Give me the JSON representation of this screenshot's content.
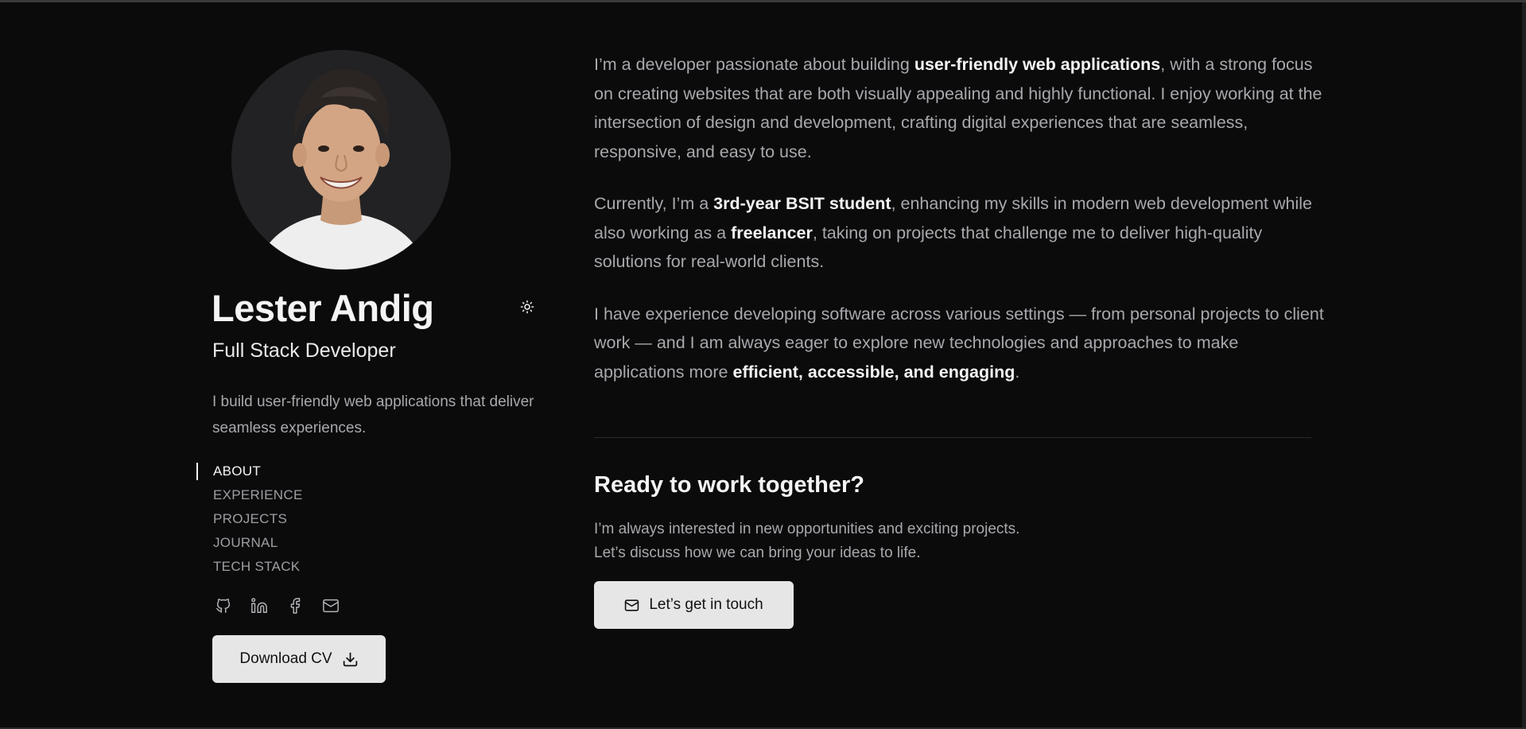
{
  "profile": {
    "name": "Lester Andig",
    "role": "Full Stack Developer",
    "tagline": "I build user-friendly web applications that deliver seamless experiences."
  },
  "nav": {
    "items": [
      {
        "label": "ABOUT",
        "active": true
      },
      {
        "label": "EXPERIENCE",
        "active": false
      },
      {
        "label": "PROJECTS",
        "active": false
      },
      {
        "label": "JOURNAL",
        "active": false
      },
      {
        "label": "TECH STACK",
        "active": false
      }
    ]
  },
  "socials": [
    {
      "icon": "github-icon"
    },
    {
      "icon": "linkedin-icon"
    },
    {
      "icon": "facebook-icon"
    },
    {
      "icon": "mail-icon"
    }
  ],
  "download_button": {
    "label": "Download CV",
    "icon": "download-icon"
  },
  "theme_toggle": {
    "icon": "sun-icon"
  },
  "about": {
    "p1": {
      "a": "I’m a developer passionate about building ",
      "b": "user-friendly web applications",
      "c": ", with a strong focus on creating websites that are both visually appealing and highly functional. I enjoy working at the intersection of design and development, crafting digital experiences that are seamless, responsive, and easy to use."
    },
    "p2": {
      "a": "Currently, I’m a ",
      "b": "3rd-year BSIT student",
      "c": ", enhancing my skills in modern web development while also working as a ",
      "d": "freelancer",
      "e": ", taking on projects that challenge me to deliver high-quality solutions for real-world clients."
    },
    "p3": {
      "a": "I have experience developing software across various settings — from personal projects to client work — and I am always eager to explore new technologies and approaches to make applications more ",
      "b": "efficient, accessible, and engaging",
      "c": "."
    }
  },
  "cta": {
    "title": "Ready to work together?",
    "text": "I’m always interested in new opportunities and exciting projects. Let’s discuss how we can bring your ideas to life.",
    "button_label": "Let’s get in touch",
    "button_icon": "mail-icon"
  },
  "colors": {
    "background": "#0b0b0c",
    "text_primary": "#f4f4f5",
    "text_muted": "#a8a8ad",
    "button_bg": "#e6e6e7"
  }
}
